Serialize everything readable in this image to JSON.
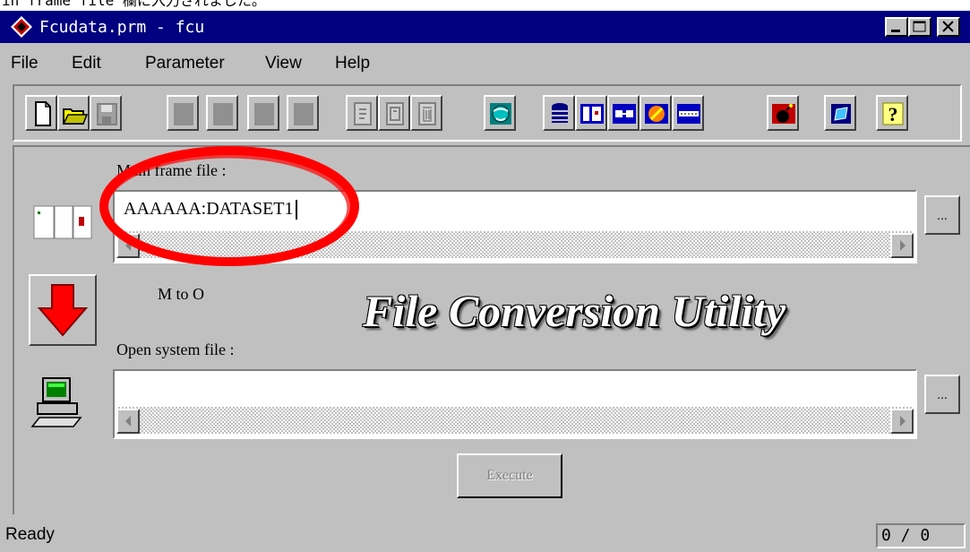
{
  "caption": "in frame file 欄に入力されました。",
  "window": {
    "title": "Fcudata.prm - fcu",
    "controls": [
      "minimize",
      "maximize",
      "close"
    ]
  },
  "menu": {
    "items": [
      "File",
      "Edit",
      "Parameter",
      "View",
      "Help"
    ]
  },
  "toolbar": {
    "icons": [
      "new-file-icon",
      "open-folder-icon",
      "save-icon",
      "blank-tool-1",
      "blank-tool-2",
      "blank-tool-3",
      "blank-tool-4",
      "copy-icon",
      "edit-icon",
      "delete-icon",
      "globe-icon",
      "database-icon",
      "layout-icon",
      "connect-icon",
      "color-icon",
      "separator-icon",
      "bomb-icon",
      "edit-note-icon",
      "help-icon"
    ]
  },
  "main": {
    "mainframe_label": "Main frame file :",
    "mainframe_value": "AAAAAA:DATASET1",
    "direction_label": "M to O",
    "banner": "File Conversion Utility",
    "opensystem_label": "Open system file :",
    "opensystem_value": "",
    "browse_label": "...",
    "execute_label": "Execute"
  },
  "status": {
    "text": "Ready",
    "count": "0 / 0"
  },
  "colors": {
    "titlebar": "#000080",
    "face": "#c0c0c0",
    "highlight_circle": "#ff0000",
    "arrow": "#ff0000"
  }
}
